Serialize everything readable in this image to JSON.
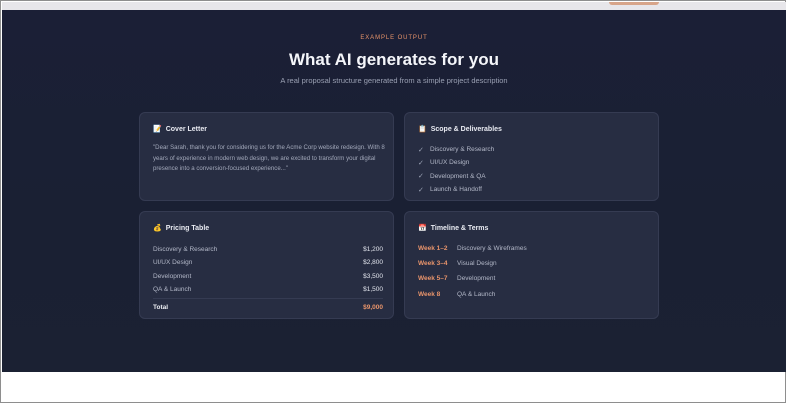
{
  "header": {
    "eyebrow": "EXAMPLE OUTPUT",
    "title": "What AI generates for you",
    "subtitle": "A real proposal structure generated from a simple project description"
  },
  "cover_letter": {
    "icon": "memo-icon",
    "icon_glyph": "📝",
    "title": "Cover Letter",
    "text": "\"Dear Sarah, thank you for considering us for the Acme Corp website redesign. With 8 years of experience in modern web design, we are excited to transform your digital presence into a conversion-focused experience...\""
  },
  "scope": {
    "icon": "clipboard-icon",
    "icon_glyph": "📋",
    "title": "Scope & Deliverables",
    "items": [
      {
        "label": "Discovery & Research"
      },
      {
        "label": "UI/UX Design"
      },
      {
        "label": "Development & QA"
      },
      {
        "label": "Launch & Handoff"
      }
    ]
  },
  "pricing": {
    "icon": "money-bag-icon",
    "icon_glyph": "💰",
    "title": "Pricing Table",
    "rows": [
      {
        "item": "Discovery & Research",
        "amount": "$1,200"
      },
      {
        "item": "UI/UX Design",
        "amount": "$2,800"
      },
      {
        "item": "Development",
        "amount": "$3,500"
      },
      {
        "item": "QA & Launch",
        "amount": "$1,500"
      }
    ],
    "total_label": "Total",
    "total_amount": "$9,000"
  },
  "timeline": {
    "icon": "calendar-icon",
    "icon_glyph": "📅",
    "title": "Timeline & Terms",
    "rows": [
      {
        "week": "Week 1–2",
        "desc": "Discovery & Wireframes"
      },
      {
        "week": "Week 3–4",
        "desc": "Visual Design"
      },
      {
        "week": "Week 5–7",
        "desc": "Development"
      },
      {
        "week": "Week 8",
        "desc": "QA & Launch"
      }
    ]
  },
  "colors": {
    "background": "#1b1f36",
    "card": "#272d42",
    "accent": "#e8946b",
    "text": "#f5f6fa"
  }
}
